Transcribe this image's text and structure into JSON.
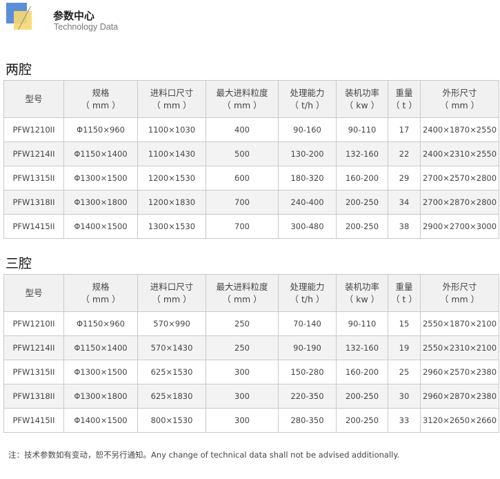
{
  "header": {
    "title": "参数中心",
    "subtitle": "Technology Data"
  },
  "columns": [
    {
      "label": "型号",
      "unit": ""
    },
    {
      "label": "规格",
      "unit": "（ mm ）"
    },
    {
      "label": "进料口尺寸",
      "unit": "（ mm ）"
    },
    {
      "label": "最大进料粒度",
      "unit": "（ mm ）"
    },
    {
      "label": "处理能力",
      "unit": "（ t/h ）"
    },
    {
      "label": "装机功率",
      "unit": "（ kw ）"
    },
    {
      "label": "重量",
      "unit": "（ t ）"
    },
    {
      "label": "外形尺寸",
      "unit": "（ mm ）"
    }
  ],
  "tables": [
    {
      "title": "两腔",
      "rows": [
        [
          "PFW1210II",
          "Φ1150×960",
          "1100×1030",
          "400",
          "90-160",
          "90-110",
          "17",
          "2400×1870×2550"
        ],
        [
          "PFW1214II",
          "Φ1150×1400",
          "1100×1430",
          "500",
          "130-200",
          "132-160",
          "22",
          "2400×2310×2550"
        ],
        [
          "PFW1315II",
          "Φ1300×1500",
          "1200×1530",
          "600",
          "180-320",
          "160-200",
          "29",
          "2700×2570×2800"
        ],
        [
          "PFW1318II",
          "Φ1300×1800",
          "1200×1830",
          "700",
          "240-400",
          "200-250",
          "34",
          "2700×2870×2800"
        ],
        [
          "PFW1415II",
          "Φ1400×1500",
          "1300×1530",
          "700",
          "300-480",
          "200-250",
          "38",
          "2900×2700×3000"
        ]
      ]
    },
    {
      "title": "三腔",
      "rows": [
        [
          "PFW1210II",
          "Φ1150×960",
          "570×990",
          "250",
          "70-140",
          "90-110",
          "15",
          "2550×1870×2100"
        ],
        [
          "PFW1214II",
          "Φ1150×1400",
          "570×1430",
          "250",
          "90-190",
          "132-160",
          "19",
          "2550×2310×2100"
        ],
        [
          "PFW1315II",
          "Φ1300×1500",
          "625×1530",
          "300",
          "150-280",
          "160-200",
          "25",
          "2960×2570×2380"
        ],
        [
          "PFW1318II",
          "Φ1300×1800",
          "625×1830",
          "300",
          "220-350",
          "200-250",
          "30",
          "2960×2870×2380"
        ],
        [
          "PFW1415II",
          "Φ1400×1500",
          "800×1530",
          "300",
          "280-350",
          "200-250",
          "33",
          "3120×2650×2660"
        ]
      ]
    }
  ],
  "note": "注：技术参数如有变动，恕不另行通知。Any change of technical data shall not be advised additionally."
}
